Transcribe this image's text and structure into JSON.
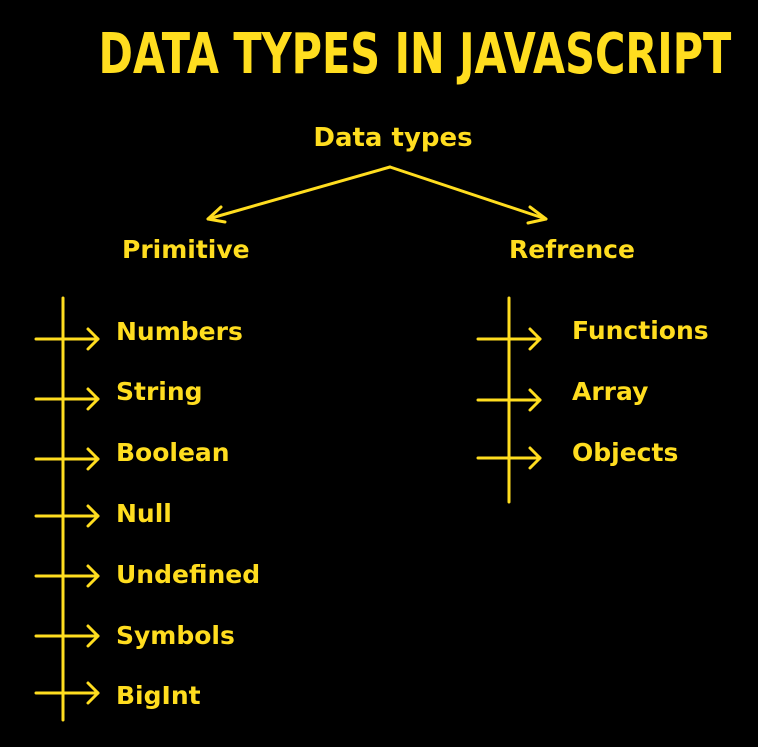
{
  "title": "DATA TYPES IN JAVASCRIPT",
  "root": "Data types",
  "colors": {
    "background": "#000000",
    "accent": "#FFDD1F"
  },
  "branches": {
    "primitive": {
      "label": "Primitive",
      "items": [
        "Numbers",
        "String",
        "Boolean",
        "Null",
        "Undefined",
        "Symbols",
        "BigInt"
      ]
    },
    "reference": {
      "label": "Refrence",
      "items": [
        "Functions",
        "Array",
        "Objects"
      ]
    }
  }
}
